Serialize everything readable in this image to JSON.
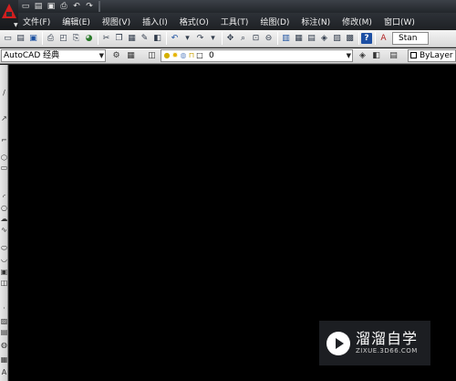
{
  "menu": {
    "items": [
      "文件(F)",
      "编辑(E)",
      "视图(V)",
      "插入(I)",
      "格式(O)",
      "工具(T)",
      "绘图(D)",
      "标注(N)",
      "修改(M)",
      "窗口(W)"
    ]
  },
  "toolbar": {
    "style_value": "Stan"
  },
  "workspace": {
    "value": "AutoCAD 经典"
  },
  "layer": {
    "name": "0"
  },
  "color_control": {
    "value": "ByLayer"
  },
  "watermark": {
    "title": "溜溜自学",
    "url": "ZIXUE.3D66.COM"
  },
  "colors": {
    "drawing_background": "#000000",
    "toolbar_background": "#e3e3e3",
    "titlebar_background": "#2d3137",
    "app_logo": "#d21f1f"
  }
}
